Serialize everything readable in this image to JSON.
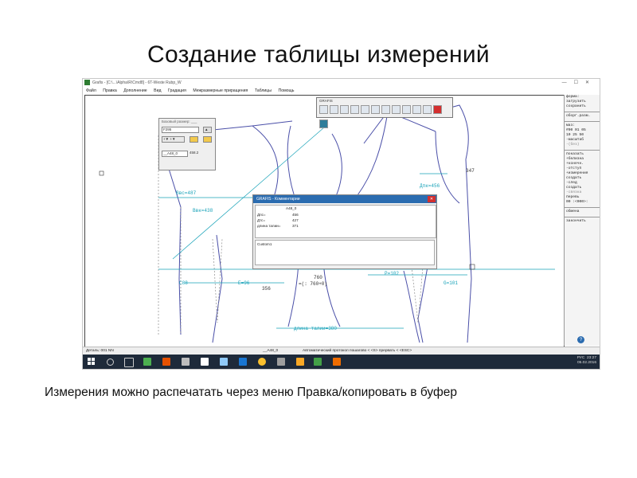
{
  "slide": {
    "title": "Создание таблицы измерений",
    "caption": "Измерения можно распечатать  через меню Правка/копировать в буфер"
  },
  "app": {
    "title": "Grafis - [C:\\...\\Alpha\\R\\Cmd8] - 6T-Weste Rubp_W",
    "menu": [
      "Файл",
      "Правка",
      "Дополнение",
      "Вид",
      "Градация",
      "Межразмерные приращения",
      "Таблицы",
      "Помощь"
    ]
  },
  "toolbar": {
    "title": "GRAFIS"
  },
  "size_panel": {
    "title": "Базовый размер: ___",
    "size_value": "F295",
    "part_name": "__A48_0",
    "part_value": "458.2"
  },
  "comment_dialog": {
    "title": "GRAFIS - Комментарии",
    "column_header": "A48_0",
    "rows": [
      {
        "label": "Дпс=",
        "value": "456"
      },
      {
        "label": "Дтс=",
        "value": "427"
      },
      {
        "label": "длина талии=",
        "value": "371"
      }
    ],
    "text": "Custom1"
  },
  "drawing_labels": {
    "bvs": "Ввс=487",
    "bvk": "Ввк=438",
    "dpk": "Дпк=456",
    "c88": "C88",
    "e96": "Е=96",
    "p102": "P=102",
    "g101": "G=101",
    "n760": "760",
    "n760b": "=(: 760+0)",
    "n347": "347",
    "n356": "356",
    "waist": "длина талии=380"
  },
  "right_panel": [
    "форма:",
    " загрузить",
    " сохранить",
    "оборг.разм.",
    "маз:",
    "#00  01  05",
    " 10  25  50",
    " -масштаб",
    " -(без)",
    "показать",
    " +белизна",
    " +конечн.",
    " -отступ",
    " +измерения",
    "  создать",
    " -след",
    "  создать",
    " -связка",
    "  перевь",
    "00 :<000>:",
    "обмена",
    "закончить"
  ],
  "statusbar": {
    "left": "Деталь: 001  NN",
    "part": "__A48_0",
    "center": "Автоматический протокол пошагово < <S> прервать < <ESC>"
  },
  "taskbar": {
    "lang": "РУС",
    "time": "23:27",
    "date": "05.02.2016"
  }
}
